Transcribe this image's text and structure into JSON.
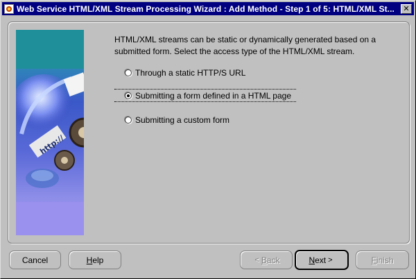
{
  "window": {
    "title": "Web Service HTML/XML Stream Processing Wizard : Add Method - Step 1 of 5: HTML/XML St...",
    "close_glyph": "✕"
  },
  "main": {
    "intro": "HTML/XML streams can be static or dynamically generated based on a submitted form. Select the access type of the HTML/XML stream.",
    "options": [
      {
        "label": "Through a static HTTP/S URL",
        "checked": false
      },
      {
        "label": "Submitting a form defined in a HTML page",
        "checked": true
      },
      {
        "label": "Submitting a custom form",
        "checked": false
      }
    ],
    "banner_text": "http://"
  },
  "buttons": {
    "cancel": "Cancel",
    "help_mnemonic": "H",
    "help_rest": "elp",
    "back_arrow": "<",
    "back_mnemonic": "B",
    "back_rest": "ack",
    "next_mnemonic": "N",
    "next_rest": "ext",
    "next_arrow": ">",
    "finish_mnemonic": "F",
    "finish_rest": "inish"
  },
  "colors": {
    "titlebar": "#000080",
    "face": "#c0c0c0",
    "banner_teal": "#1f8f9a",
    "banner_lavender": "#9a90ee"
  },
  "icons": [
    "app-icon",
    "close-icon",
    "radio-icon",
    "wizard-banner-image"
  ]
}
